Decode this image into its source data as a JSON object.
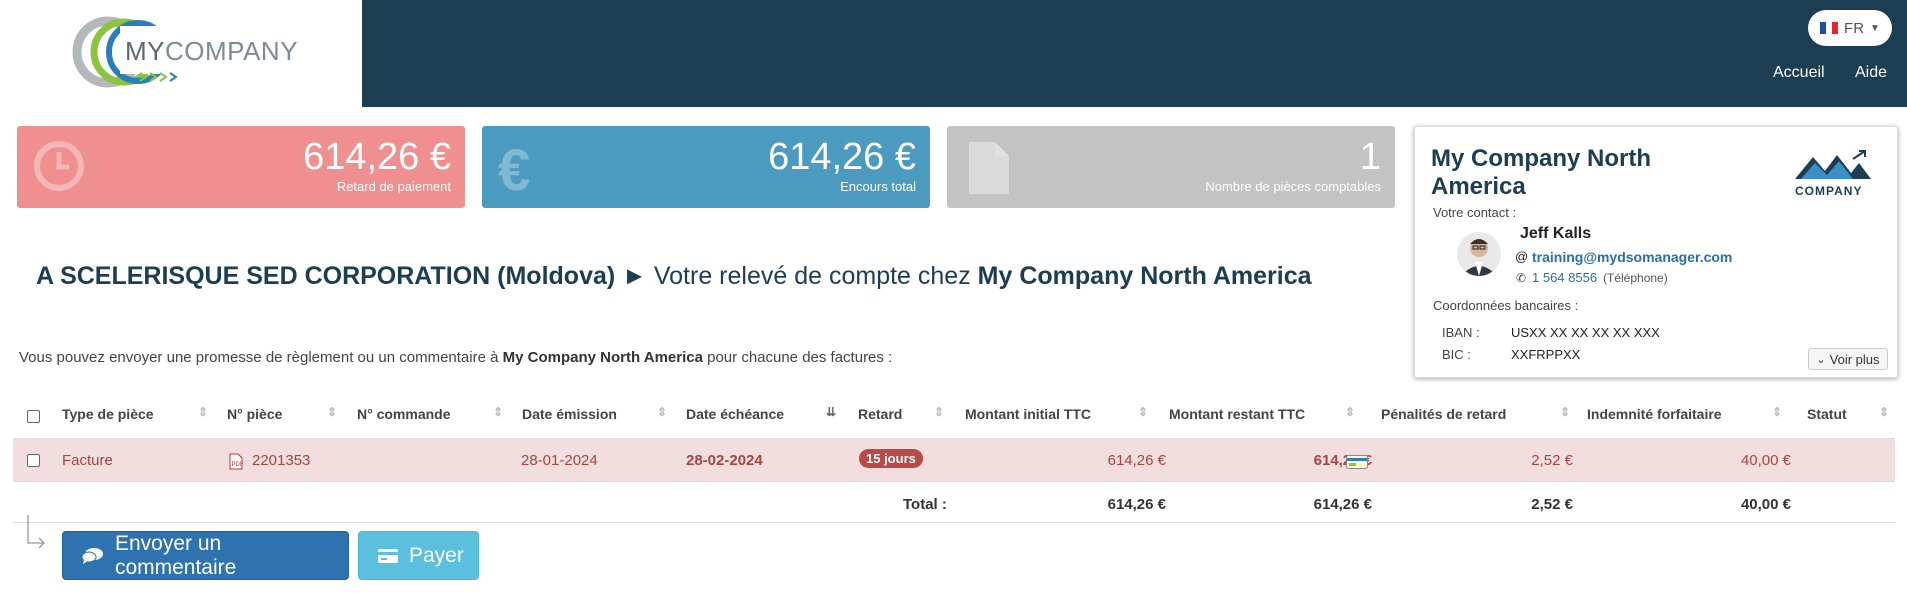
{
  "header": {
    "logo_text_a": "MY",
    "logo_text_b": "COMPANY",
    "language": "FR",
    "nav": [
      {
        "label": "Accueil"
      },
      {
        "label": "Aide"
      }
    ]
  },
  "kpis": [
    {
      "value": "614,26 €",
      "label": "Retard de paiement",
      "color": "#f08f8f",
      "icon": "clock-icon"
    },
    {
      "value": "614,26 €",
      "label": "Encours total",
      "color": "#4b9ac0",
      "icon": "euro-icon"
    },
    {
      "value": "1",
      "label": "Nombre de pièces comptables",
      "color": "#c3c3c3",
      "icon": "document-icon"
    }
  ],
  "company_card": {
    "name": "My Company North America",
    "logo_text": "COMPANY",
    "contact_label": "Votre contact :",
    "contact_name": "Jeff Kalls",
    "email": "training@mydsomanager.com",
    "phone": "1 564 8556",
    "phone_type": "(Téléphone)",
    "bank_label": "Coordonnées bancaires :",
    "iban_label": "IBAN :",
    "iban": "USXX XX XX XX XX XXX",
    "bic_label": "BIC :",
    "bic": "XXFRPPXX",
    "more_button": "Voir plus"
  },
  "heading": {
    "client": "A SCELERISQUE SED CORPORATION (Moldova)",
    "arrow": "►",
    "middle": "Votre relevé de compte chez",
    "company": "My Company North America"
  },
  "intro": {
    "before": "Vous pouvez envoyer une promesse de règlement ou un commentaire à",
    "company": "My Company North America",
    "after": "pour chacune des factures :"
  },
  "table": {
    "columns": [
      "Type de pièce",
      "N° pièce",
      "N° commande",
      "Date émission",
      "Date échéance",
      "Retard",
      "Montant initial TTC",
      "Montant restant TTC",
      "Pénalités de retard",
      "Indemnité forfaitaire",
      "Statut"
    ],
    "rows": [
      {
        "type": "Facture",
        "piece": "2201353",
        "commande": "",
        "emission": "28-01-2024",
        "echeance": "28-02-2024",
        "retard": "15 jours",
        "initial": "614,26 €",
        "restant": "614,26 €",
        "penalites": "2,52 €",
        "indemnite": "40,00 €",
        "statut": ""
      }
    ],
    "total": {
      "label": "Total :",
      "initial": "614,26 €",
      "restant": "614,26 €",
      "penalites": "2,52 €",
      "indemnite": "40,00 €"
    }
  },
  "actions": {
    "comment": "Envoyer un commentaire",
    "pay": "Payer"
  }
}
